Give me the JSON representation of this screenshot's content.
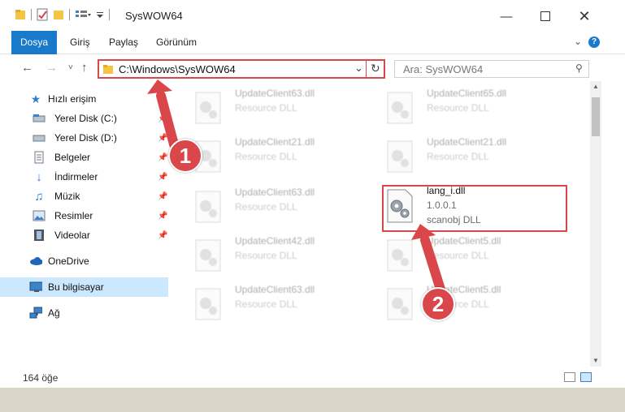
{
  "window": {
    "title": "SysWOW64",
    "minimize_icon": "minimize-icon",
    "maximize_icon": "maximize-icon",
    "close_icon": "close-icon"
  },
  "ribbon": {
    "tabs": [
      {
        "label": "Dosya"
      },
      {
        "label": "Giriş"
      },
      {
        "label": "Paylaş"
      },
      {
        "label": "Görünüm"
      }
    ]
  },
  "address": {
    "path": "C:\\Windows\\SysWOW64",
    "search_placeholder": "Ara: SysWOW64"
  },
  "sidebar": {
    "items": [
      {
        "label": "Hızlı erişim"
      },
      {
        "label": "Yerel Disk (C:)"
      },
      {
        "label": "Yerel Disk (D:)"
      },
      {
        "label": "Belgeler"
      },
      {
        "label": "İndirmeler"
      },
      {
        "label": "Müzik"
      },
      {
        "label": "Resimler"
      },
      {
        "label": "Videolar"
      },
      {
        "label": "OneDrive"
      },
      {
        "label": "Bu bilgisayar"
      },
      {
        "label": "Ağ"
      }
    ]
  },
  "files": [
    {
      "name": "UpdateClient63.dll",
      "sub1": "Resource DLL",
      "sub2": ""
    },
    {
      "name": "UpdateClient65.dll",
      "sub1": "Resource DLL",
      "sub2": ""
    },
    {
      "name": "UpdateClient21.dll",
      "sub1": "Resource DLL",
      "sub2": ""
    },
    {
      "name": "UpdateClient21.dll",
      "sub1": "Resource DLL",
      "sub2": ""
    },
    {
      "name": "UpdateClient63.dll",
      "sub1": "Resource DLL",
      "sub2": ""
    },
    {
      "name": "lang_i.dll",
      "sub1": "1.0.0.1",
      "sub2": "scanobj DLL"
    },
    {
      "name": "UpdateClient42.dll",
      "sub1": "Resource DLL",
      "sub2": ""
    },
    {
      "name": "UpdateClient5.dll",
      "sub1": "Resource DLL",
      "sub2": ""
    },
    {
      "name": "UpdateClient63.dll",
      "sub1": "Resource DLL",
      "sub2": ""
    },
    {
      "name": "UpdateClient5.dll",
      "sub1": "Resource DLL",
      "sub2": ""
    }
  ],
  "status": {
    "count": "164 öğe"
  },
  "callouts": [
    {
      "label": "1"
    },
    {
      "label": "2"
    }
  ],
  "colors": {
    "accent": "#1979ca",
    "annotation_red": "#d9474a"
  }
}
